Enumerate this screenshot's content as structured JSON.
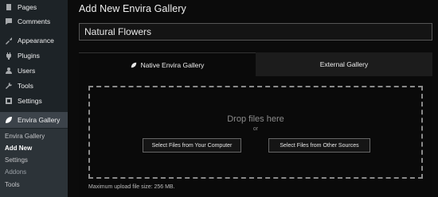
{
  "sidebar": {
    "items": [
      {
        "label": "Pages",
        "icon": "pages-icon"
      },
      {
        "label": "Comments",
        "icon": "comments-icon"
      },
      {
        "label": "Appearance",
        "icon": "appearance-icon"
      },
      {
        "label": "Plugins",
        "icon": "plugins-icon"
      },
      {
        "label": "Users",
        "icon": "users-icon"
      },
      {
        "label": "Tools",
        "icon": "tools-icon"
      },
      {
        "label": "Settings",
        "icon": "settings-icon"
      },
      {
        "label": "Envira Gallery",
        "icon": "envira-leaf-icon"
      }
    ],
    "submenu": [
      {
        "label": "Envira Gallery"
      },
      {
        "label": "Add New"
      },
      {
        "label": "Settings"
      },
      {
        "label": "Addons"
      },
      {
        "label": "Tools"
      }
    ]
  },
  "main": {
    "page_title": "Add New Envira Gallery",
    "gallery_title_value": "Natural Flowers",
    "tabs": [
      {
        "label": "Native Envira Gallery"
      },
      {
        "label": "External Gallery"
      }
    ],
    "uploader": {
      "drop_text": "Drop files here",
      "or_text": "or",
      "select_computer": "Select Files from Your Computer",
      "select_other": "Select Files from Other Sources",
      "max_upload": "Maximum upload file size: 256 MB."
    }
  }
}
